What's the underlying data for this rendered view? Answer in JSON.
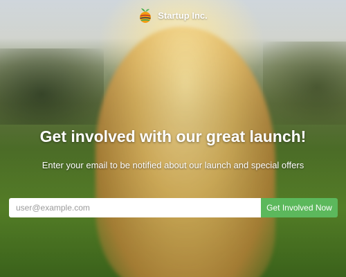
{
  "brand": {
    "name": "Startup Inc.",
    "logo_icon": "orange-fruit-logo-icon"
  },
  "hero": {
    "headline": "Get involved with our great launch!",
    "subtitle": "Enter your email to be notified about our launch and special offers"
  },
  "signup": {
    "email_placeholder": "user@example.com",
    "email_value": "",
    "button_label": "Get Involved Now"
  },
  "colors": {
    "button_bg": "#5cb85c",
    "text": "#ffffff"
  }
}
